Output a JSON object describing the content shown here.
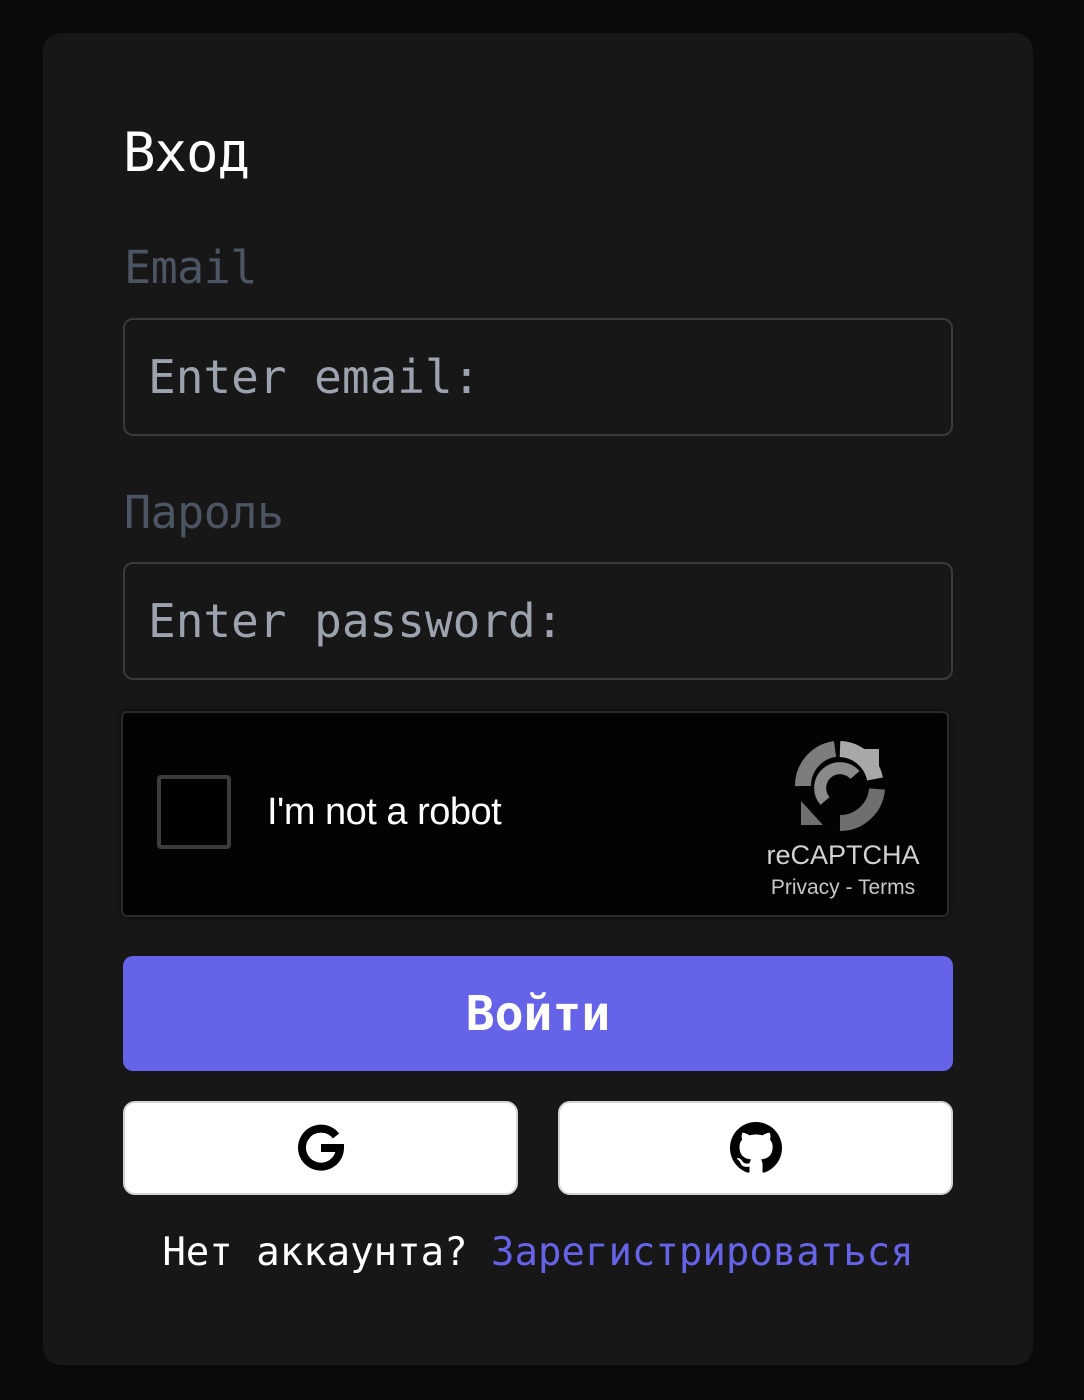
{
  "form": {
    "title": "Вход",
    "email": {
      "label": "Email",
      "placeholder": "Enter email:"
    },
    "password": {
      "label": "Пароль",
      "placeholder": "Enter password:"
    },
    "submit_label": "Войти"
  },
  "recaptcha": {
    "checkbox_label": "I'm not a robot",
    "brand": "reCAPTCHA",
    "privacy_link": "Privacy",
    "separator": " - ",
    "terms_link": "Terms"
  },
  "oauth": {
    "providers": [
      {
        "id": "google",
        "icon": "google-icon"
      },
      {
        "id": "github",
        "icon": "github-icon"
      }
    ]
  },
  "footer": {
    "prompt": "Нет аккаунта? ",
    "register_link": "Зарегистрироваться"
  },
  "colors": {
    "page_background": "#0a0a0a",
    "card_background": "#171717",
    "accent": "#6563e8",
    "label_muted": "#4b5563",
    "placeholder": "#9ca3af"
  }
}
